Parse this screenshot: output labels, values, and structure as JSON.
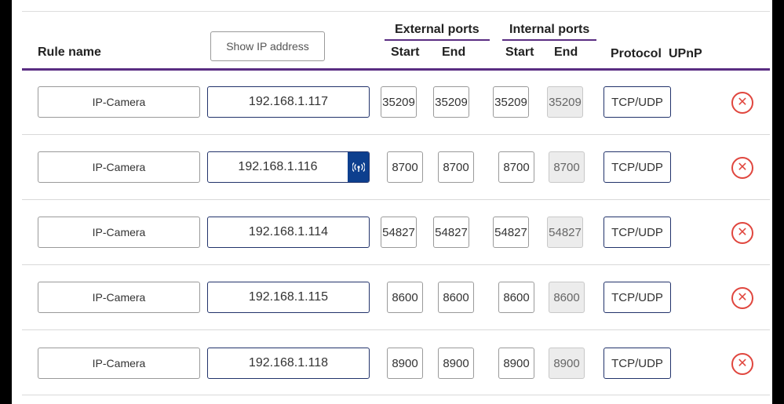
{
  "header": {
    "rule_name": "Rule name",
    "show_ip_button": "Show IP address",
    "external_ports": "External ports",
    "internal_ports": "Internal ports",
    "start": "Start",
    "end": "End",
    "protocol": "Protocol",
    "upnp": "UPnP"
  },
  "colors": {
    "accent_purple": "#5a2d82",
    "field_border_dark": "#22336b",
    "delete_red": "#e0463e",
    "wifi_badge": "#0d3f8e"
  },
  "rows": [
    {
      "name": "IP-Camera",
      "ip": "192.168.1.117",
      "ext_start": "35209",
      "ext_end": "35209",
      "int_start": "35209",
      "int_end": "35209",
      "protocol": "TCP/UDP",
      "wireless": false,
      "delete_icon": "close-circle-icon"
    },
    {
      "name": "IP-Camera",
      "ip": "192.168.1.116",
      "ext_start": "8700",
      "ext_end": "8700",
      "int_start": "8700",
      "int_end": "8700",
      "protocol": "TCP/UDP",
      "wireless": true,
      "wireless_icon": "wifi-signal-icon",
      "delete_icon": "close-circle-icon"
    },
    {
      "name": "IP-Camera",
      "ip": "192.168.1.114",
      "ext_start": "54827",
      "ext_end": "54827",
      "int_start": "54827",
      "int_end": "54827",
      "protocol": "TCP/UDP",
      "wireless": false,
      "delete_icon": "close-circle-icon"
    },
    {
      "name": "IP-Camera",
      "ip": "192.168.1.115",
      "ext_start": "8600",
      "ext_end": "8600",
      "int_start": "8600",
      "int_end": "8600",
      "protocol": "TCP/UDP",
      "wireless": false,
      "delete_icon": "close-circle-icon"
    },
    {
      "name": "IP-Camera",
      "ip": "192.168.1.118",
      "ext_start": "8900",
      "ext_end": "8900",
      "int_start": "8900",
      "int_end": "8900",
      "protocol": "TCP/UDP",
      "wireless": false,
      "delete_icon": "close-circle-icon"
    }
  ]
}
